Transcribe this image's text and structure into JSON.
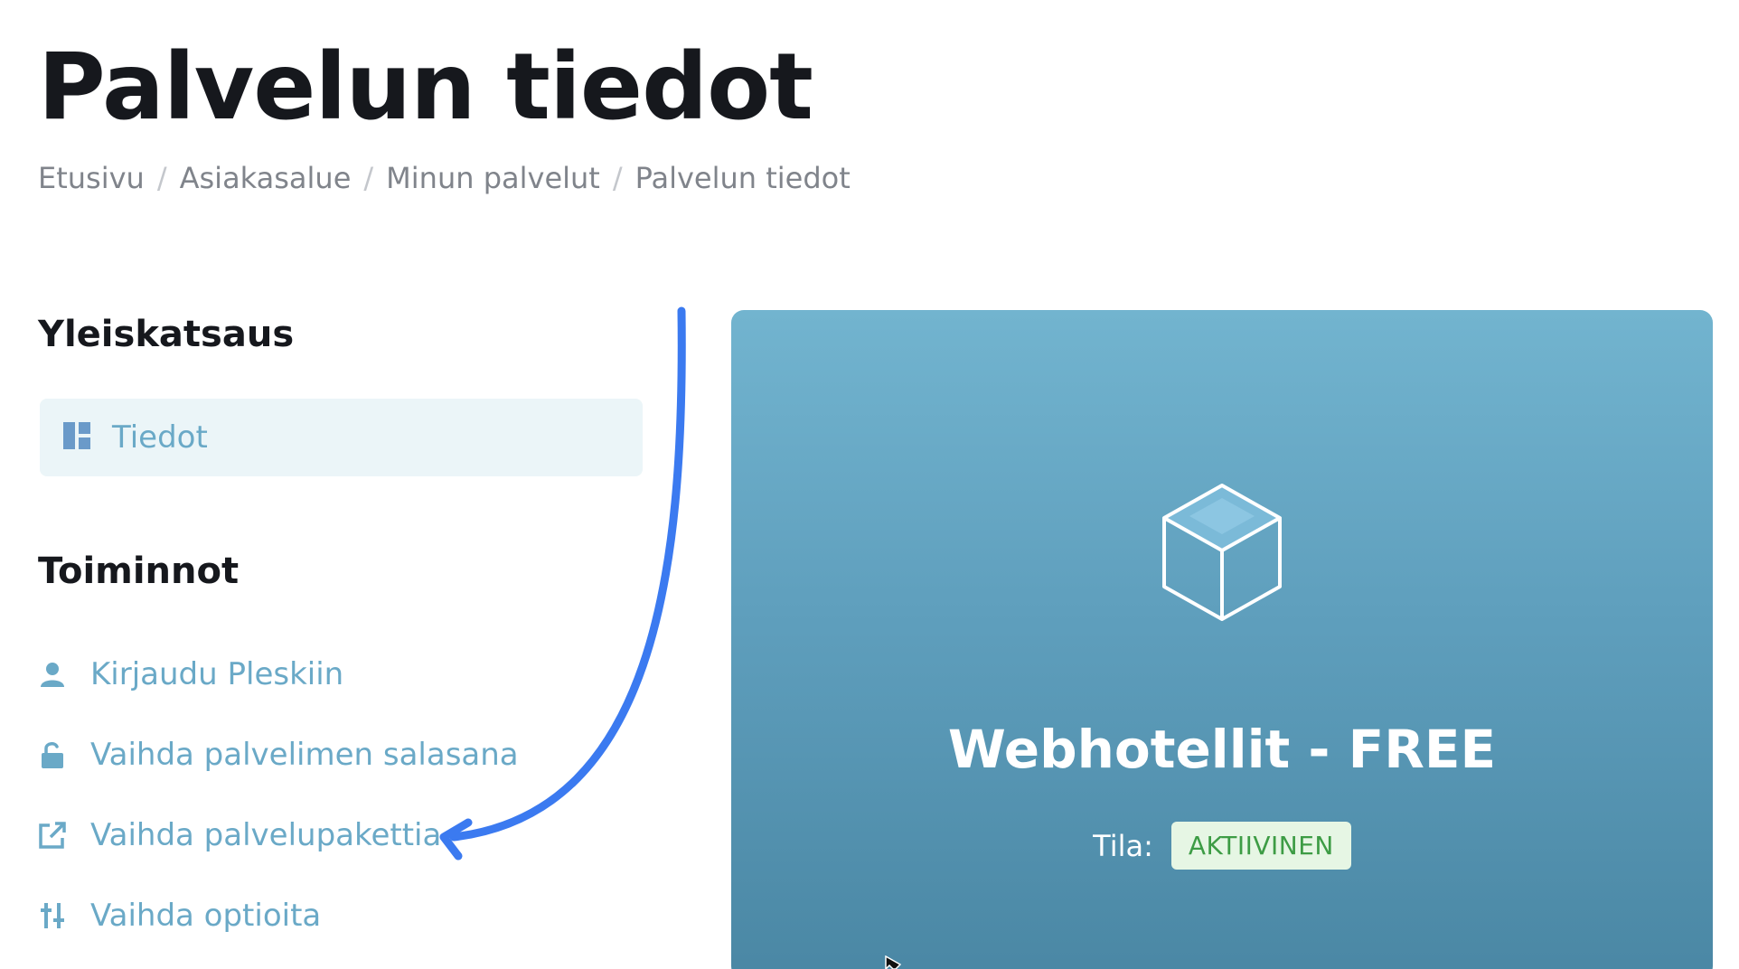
{
  "page": {
    "title": "Palvelun tiedot"
  },
  "breadcrumb": {
    "items": [
      "Etusivu",
      "Asiakasalue",
      "Minun palvelut",
      "Palvelun tiedot"
    ],
    "separator": "/"
  },
  "sidebar": {
    "overview_title": "Yleiskatsaus",
    "overview_items": [
      {
        "label": "Tiedot",
        "icon": "dashboard-icon",
        "active": true
      }
    ],
    "actions_title": "Toiminnot",
    "action_items": [
      {
        "label": "Kirjaudu Pleskiin",
        "icon": "user-icon"
      },
      {
        "label": "Vaihda palvelimen salasana",
        "icon": "unlock-icon"
      },
      {
        "label": "Vaihda palvelupakettia",
        "icon": "external-link-icon"
      },
      {
        "label": "Vaihda optioita",
        "icon": "sliders-icon"
      }
    ]
  },
  "service_card": {
    "icon": "cube-icon",
    "name": "Webhotellit - FREE",
    "status_label": "Tila:",
    "status_value": "AKTIIVINEN"
  },
  "colors": {
    "accent": "#6aa9c7",
    "active_bg": "#ebf5f8",
    "arrow": "#3b7af0",
    "card_top": "#72b4cf",
    "card_bottom": "#4a87a4",
    "status_bg": "#e6f6e4",
    "status_text": "#3d9c45"
  }
}
